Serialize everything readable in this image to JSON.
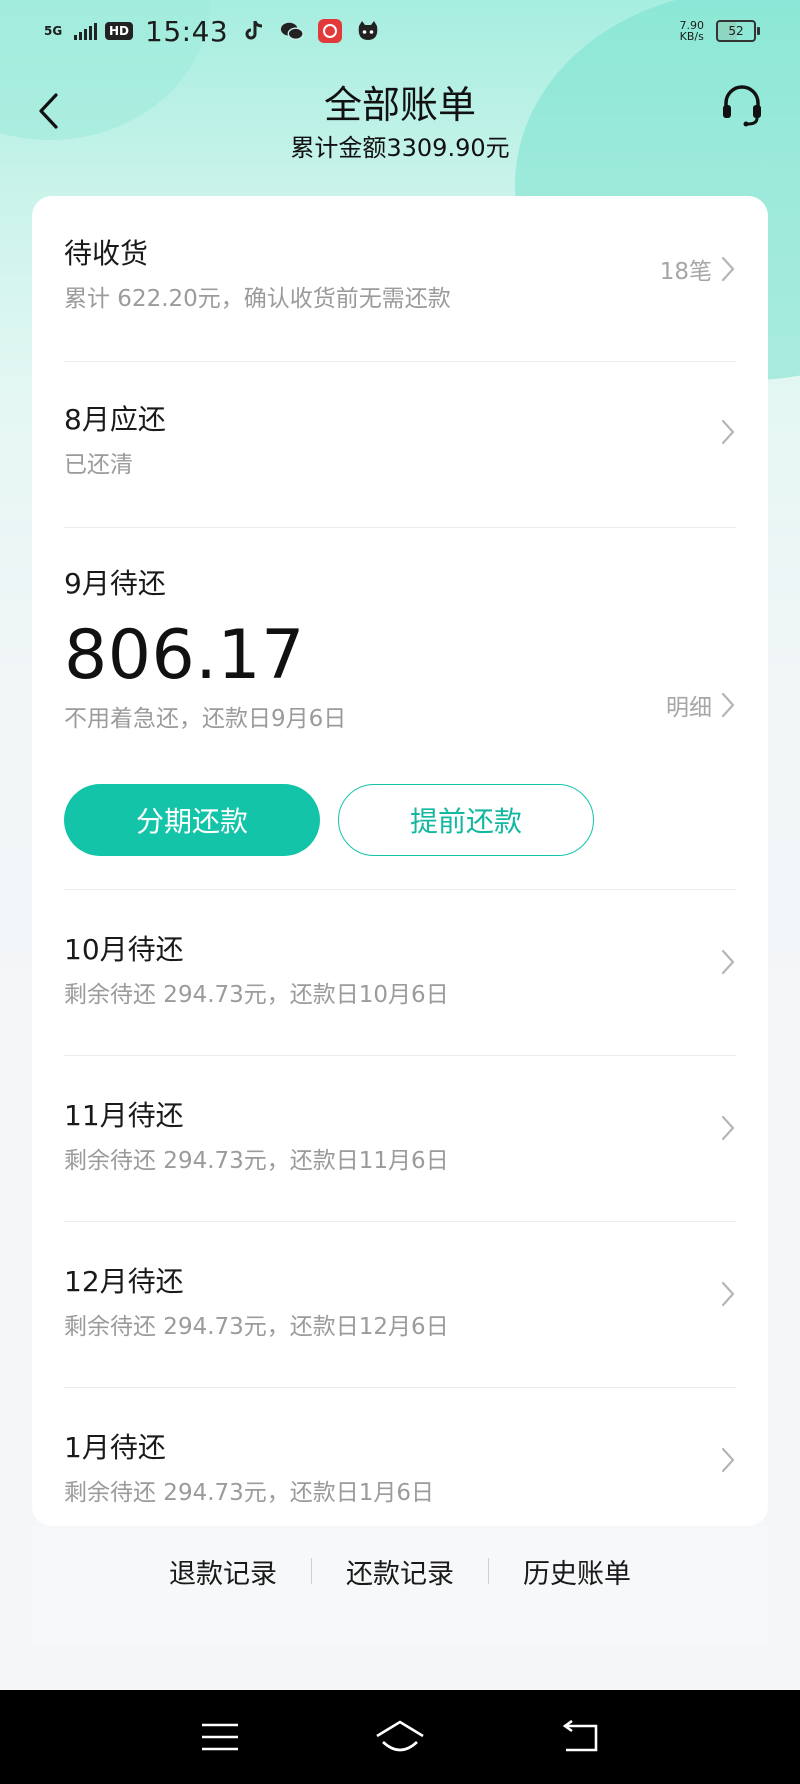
{
  "status_bar": {
    "network": "5G",
    "hd": "HD",
    "time": "15:43",
    "speed_value": "7.90",
    "speed_unit": "KB/s",
    "battery": "52",
    "battery_level": 0.52
  },
  "header": {
    "title": "全部账单",
    "subtitle": "累计金额3309.90元"
  },
  "pending_receipt": {
    "title": "待收货",
    "subtitle": "累计 622.20元，确认收货前无需还款",
    "count": "18笔"
  },
  "august": {
    "title": "8月应还",
    "subtitle": "已还清"
  },
  "september": {
    "title": "9月待还",
    "amount": "806.17",
    "subtitle": "不用着急还，还款日9月6日",
    "detail_label": "明细",
    "installment_button": "分期还款",
    "early_repay_button": "提前还款"
  },
  "months": [
    {
      "title": "10月待还",
      "subtitle": "剩余待还 294.73元，还款日10月6日"
    },
    {
      "title": "11月待还",
      "subtitle": "剩余待还 294.73元，还款日11月6日"
    },
    {
      "title": "12月待还",
      "subtitle": "剩余待还 294.73元，还款日12月6日"
    },
    {
      "title": "1月待还",
      "subtitle": "剩余待还 294.73元，还款日1月6日"
    }
  ],
  "bottom_links": {
    "refund_records": "退款记录",
    "repayment_records": "还款记录",
    "history_bills": "历史账单"
  },
  "colors": {
    "accent": "#14c4a9",
    "header_gradient": "#a6eee0"
  }
}
